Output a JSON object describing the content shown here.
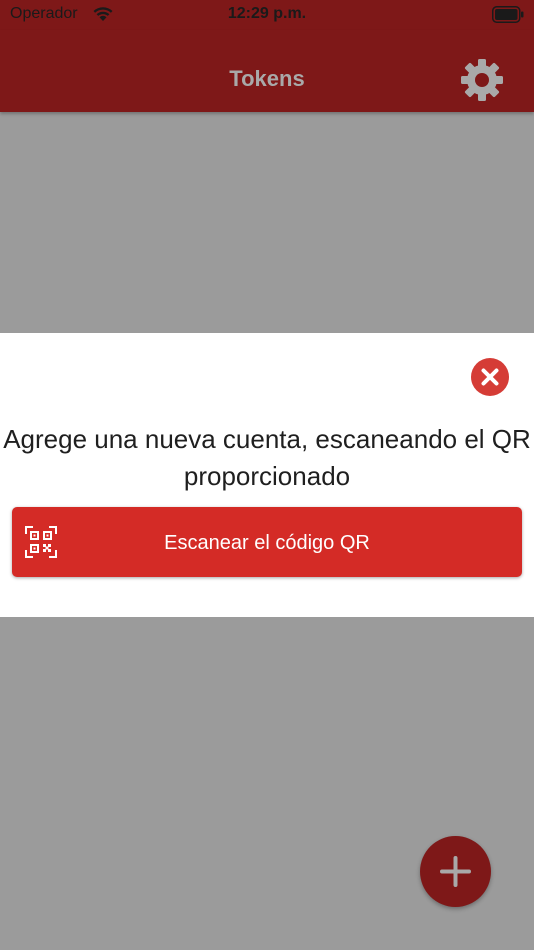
{
  "status_bar": {
    "carrier": "Operador",
    "time": "12:29 p.m.",
    "icons": [
      "wifi-icon",
      "battery-icon"
    ]
  },
  "nav_bar": {
    "title": "Tokens",
    "settings_icon": "gear-icon"
  },
  "modal": {
    "close_icon": "close-icon",
    "message": "Agrege una nueva cuenta, escaneando el QR proporcionado",
    "scan_button": {
      "icon": "qr-code-icon",
      "label": "Escanear el código QR"
    }
  },
  "fab": {
    "icon": "plus-icon"
  },
  "colors": {
    "primary": "#7e1818",
    "accent": "#d42b26",
    "close": "#d53c36",
    "backdrop": "#9b9b9b",
    "title": "#a9a9a9"
  }
}
